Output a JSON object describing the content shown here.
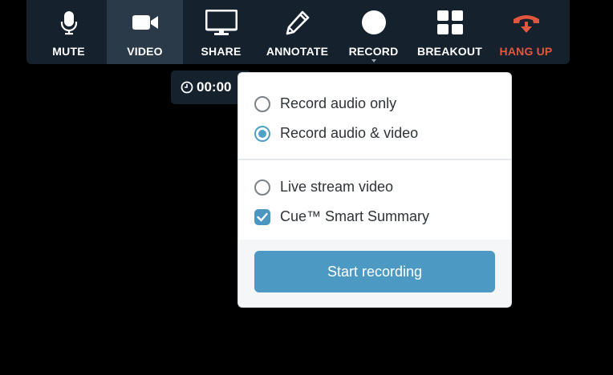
{
  "toolbar": {
    "buttons": [
      {
        "label": "MUTE",
        "icon": "microphone-icon"
      },
      {
        "label": "VIDEO",
        "icon": "video-camera-icon"
      },
      {
        "label": "SHARE",
        "icon": "monitor-icon"
      },
      {
        "label": "ANNOTATE",
        "icon": "pencil-icon"
      },
      {
        "label": "RECORD",
        "icon": "record-circle-icon"
      },
      {
        "label": "BREAKOUT",
        "icon": "grid-icon"
      },
      {
        "label": "HANG UP",
        "icon": "hang-up-phone-icon"
      }
    ],
    "colors": {
      "background": "#15212d",
      "active": "#2b3a48",
      "hangup": "#e2573e"
    }
  },
  "timer": {
    "value": "00:00",
    "icon": "clock-icon"
  },
  "record_menu": {
    "options": [
      {
        "label": "Record audio only",
        "type": "radio",
        "selected": false
      },
      {
        "label": "Record audio & video",
        "type": "radio",
        "selected": true
      }
    ],
    "extras": [
      {
        "label": "Live stream video",
        "type": "checkbox",
        "checked": false
      },
      {
        "label": "Cue™ Smart Summary",
        "type": "checkbox",
        "checked": true
      }
    ],
    "start_label": "Start recording",
    "accent": "#4c9ac4"
  }
}
